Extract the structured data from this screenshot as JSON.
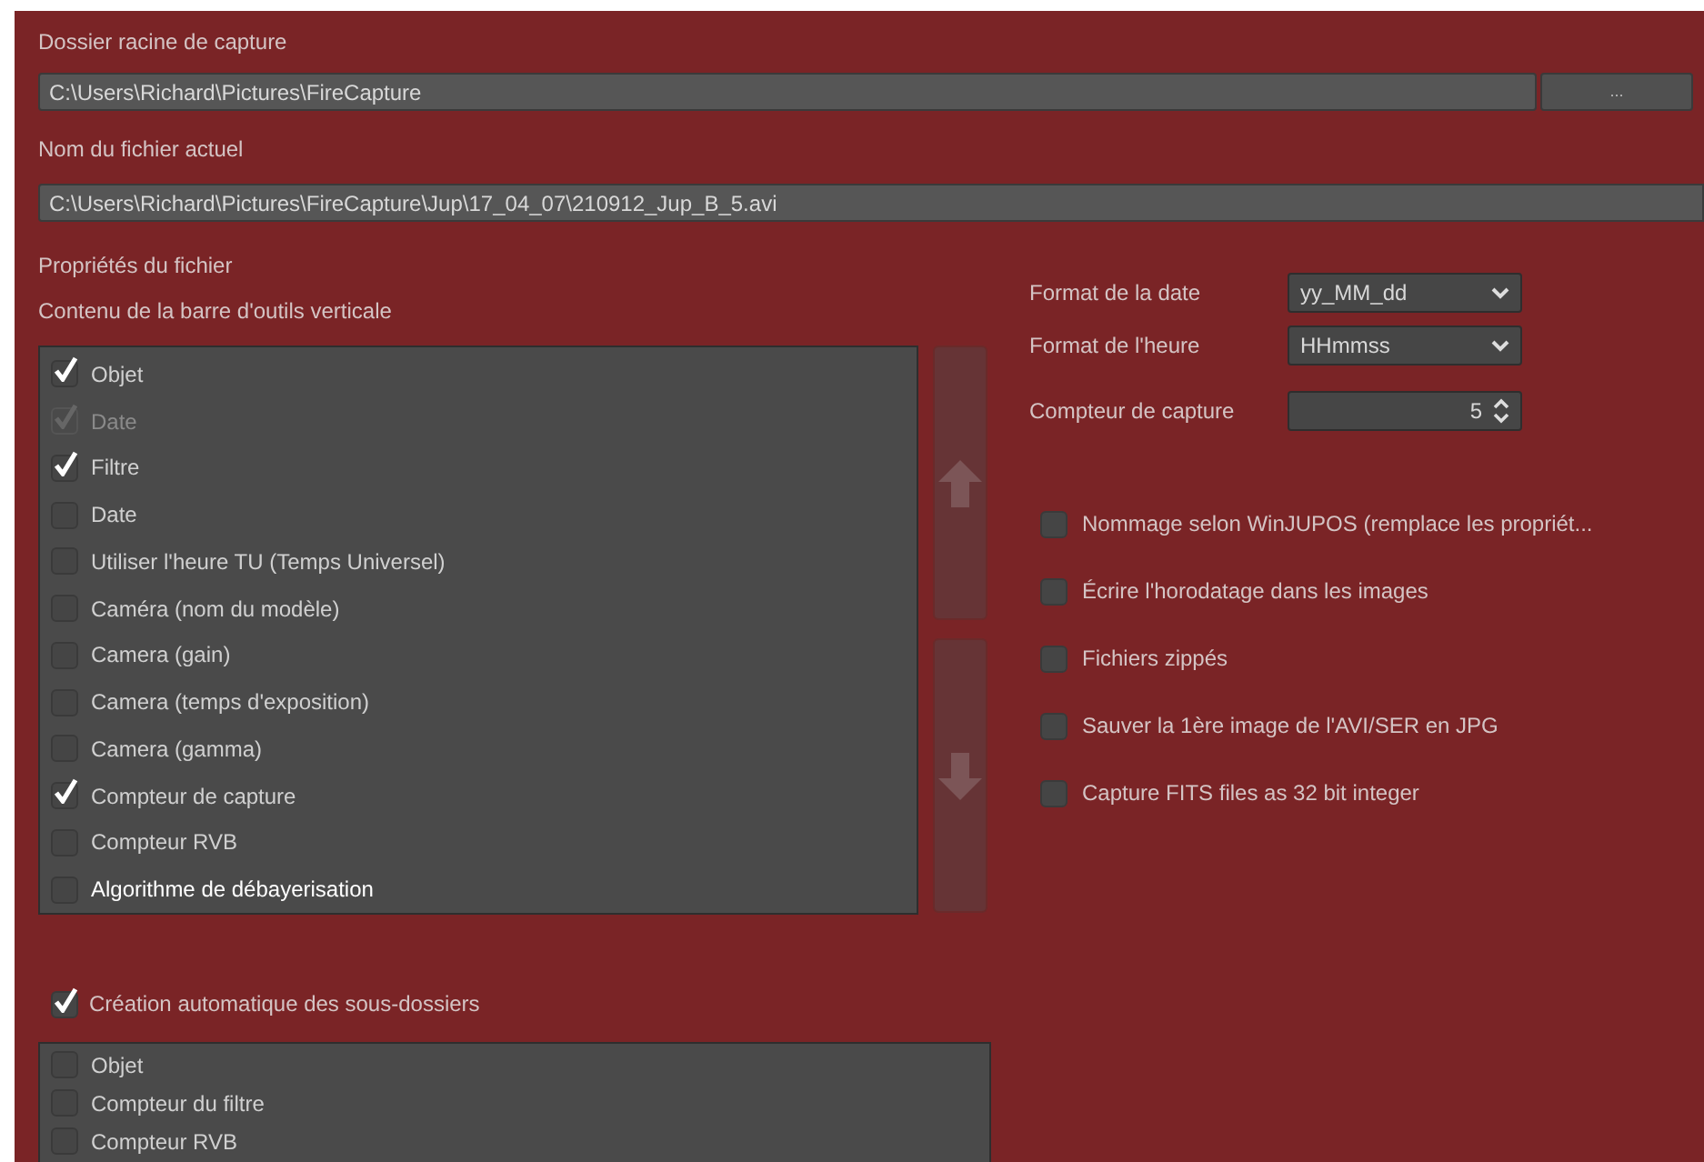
{
  "root_folder": {
    "label": "Dossier racine de capture",
    "value": "C:\\Users\\Richard\\Pictures\\FireCapture",
    "browse_button": "..."
  },
  "current_file": {
    "label": "Nom du fichier actuel",
    "value": "C:\\Users\\Richard\\Pictures\\FireCapture\\Jup\\17_04_07\\210912_Jup_B_5.avi"
  },
  "file_properties": {
    "title": "Propriétés du fichier",
    "toolbar_title": "Contenu de la barre d'outils verticale",
    "toolbar_items": [
      {
        "label": "Objet",
        "checked": true,
        "disabled": false,
        "highlighted": false
      },
      {
        "label": "Date",
        "checked": true,
        "disabled": true,
        "highlighted": false
      },
      {
        "label": "Filtre",
        "checked": true,
        "disabled": false,
        "highlighted": false
      },
      {
        "label": "Date",
        "checked": false,
        "disabled": false,
        "highlighted": false
      },
      {
        "label": "Utiliser l'heure TU (Temps Universel)",
        "checked": false,
        "disabled": false,
        "highlighted": false
      },
      {
        "label": "Caméra (nom du modèle)",
        "checked": false,
        "disabled": false,
        "highlighted": false
      },
      {
        "label": "Camera (gain)",
        "checked": false,
        "disabled": false,
        "highlighted": false
      },
      {
        "label": "Camera (temps d'exposition)",
        "checked": false,
        "disabled": false,
        "highlighted": false
      },
      {
        "label": "Camera (gamma)",
        "checked": false,
        "disabled": false,
        "highlighted": false
      },
      {
        "label": "Compteur de capture",
        "checked": true,
        "disabled": false,
        "highlighted": false
      },
      {
        "label": "Compteur RVB",
        "checked": false,
        "disabled": false,
        "highlighted": false
      },
      {
        "label": "Algorithme de débayerisation",
        "checked": false,
        "disabled": false,
        "highlighted": true
      }
    ],
    "settings": [
      {
        "kind": "select",
        "label": "Format de la date",
        "value": "yy_MM_dd"
      },
      {
        "kind": "select",
        "label": "Format de l'heure",
        "value": "HHmmss"
      },
      {
        "kind": "spinner",
        "label": "Compteur de capture",
        "value": "5"
      }
    ],
    "options": [
      {
        "label": "Nommage selon WinJUPOS (remplace les propriét...",
        "checked": false
      },
      {
        "label": "Écrire l'horodatage dans les images",
        "checked": false
      },
      {
        "label": "Fichiers zippés",
        "checked": false
      },
      {
        "label": "Sauver la 1ère image de l'AVI/SER en JPG",
        "checked": false
      },
      {
        "label": "Capture FITS files as 32 bit integer",
        "checked": false
      }
    ]
  },
  "subfolders": {
    "label": "Création automatique des sous-dossiers",
    "checked": true,
    "items": [
      {
        "label": "Objet",
        "checked": false
      },
      {
        "label": "Compteur du filtre",
        "checked": false
      },
      {
        "label": "Compteur RVB",
        "checked": false
      }
    ]
  }
}
